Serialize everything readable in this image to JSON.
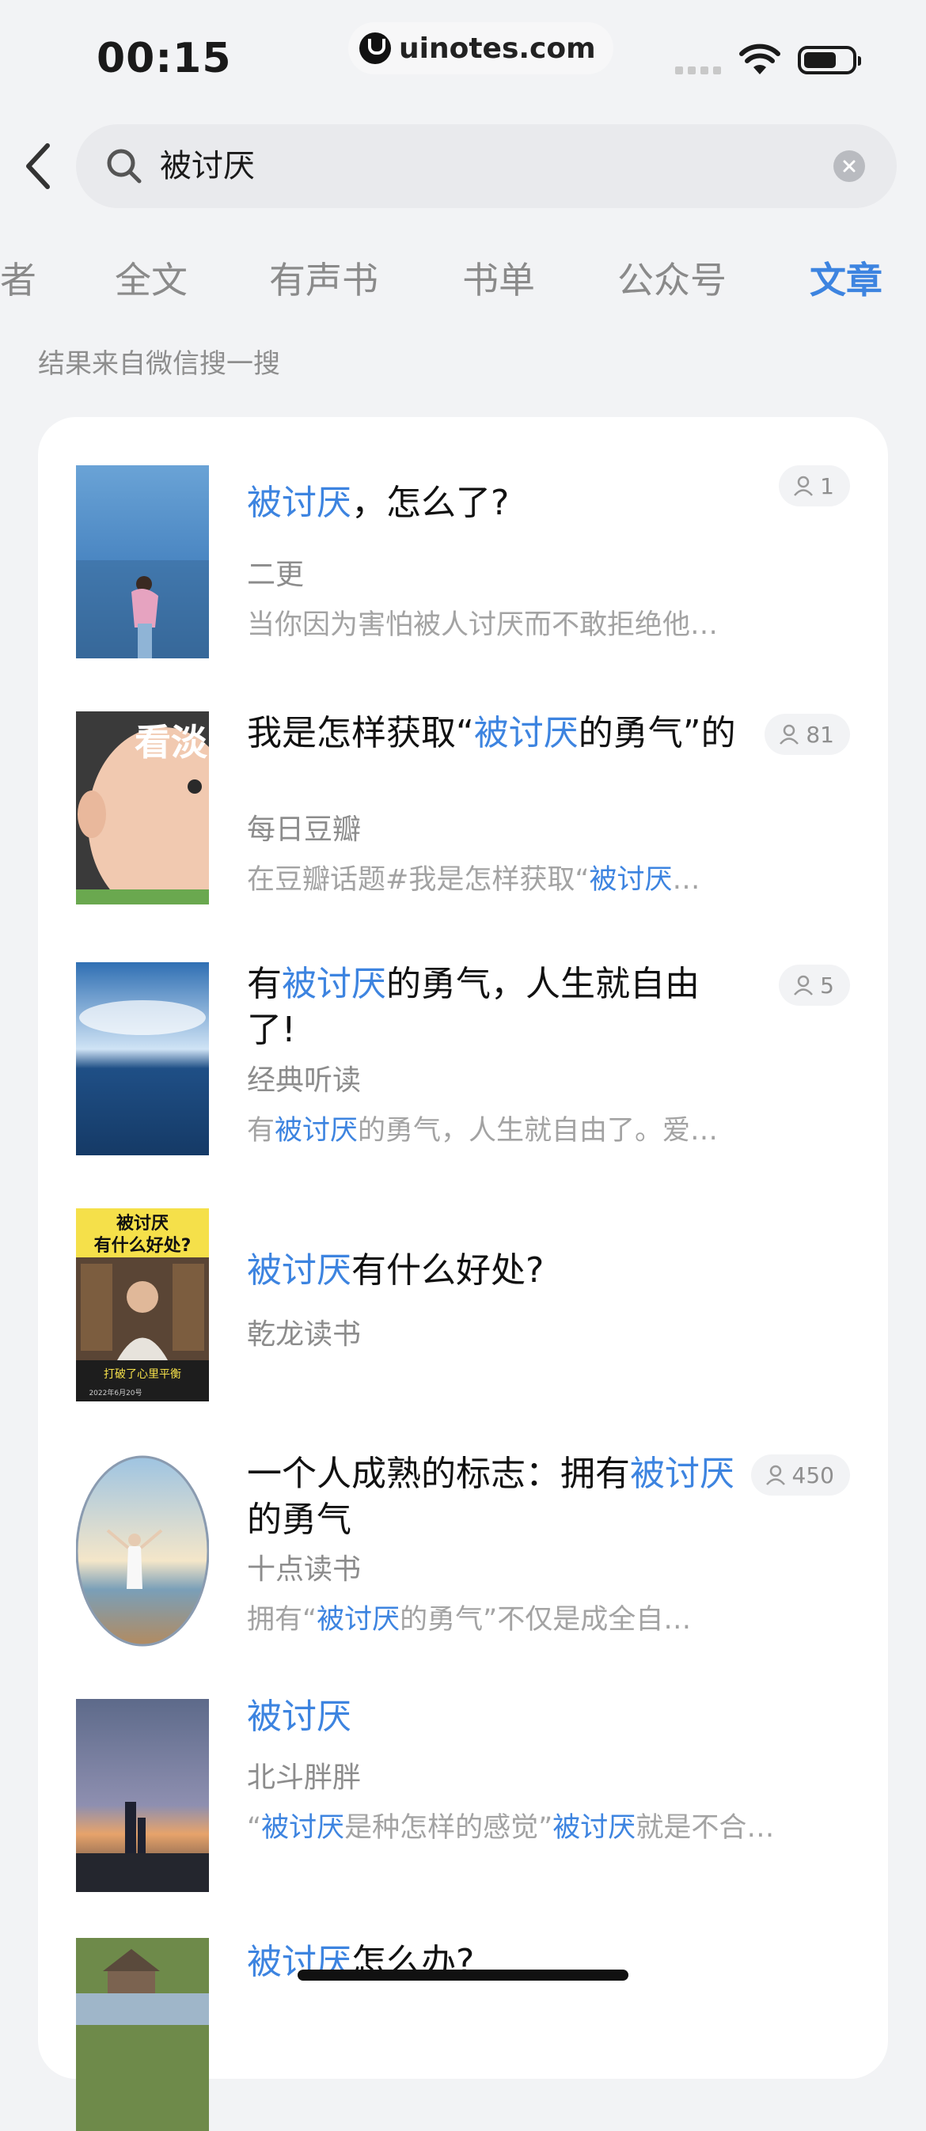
{
  "status_bar": {
    "time": "00:15",
    "watermark": "uinotes.com"
  },
  "search": {
    "query": "被讨厌"
  },
  "tabs": [
    {
      "label": "者",
      "active": false
    },
    {
      "label": "全文",
      "active": false
    },
    {
      "label": "有声书",
      "active": false
    },
    {
      "label": "书单",
      "active": false
    },
    {
      "label": "公众号",
      "active": false
    },
    {
      "label": "文章",
      "active": true
    }
  ],
  "source_note": "结果来自微信搜一搜",
  "colors": {
    "accent": "#3d84e0",
    "background": "#f2f3f5",
    "card": "#ffffff",
    "muted": "#a3a3a3"
  },
  "results": [
    {
      "title_parts": [
        {
          "t": "被讨厌",
          "hl": true
        },
        {
          "t": "，怎么了?",
          "hl": false
        }
      ],
      "author": "二更",
      "snippet_parts": [
        {
          "t": "当你因为害怕被人讨厌而不敢拒绝他…",
          "hl": false
        }
      ],
      "readers": "1"
    },
    {
      "title_parts": [
        {
          "t": "我是怎样获取“",
          "hl": false
        },
        {
          "t": "被讨厌",
          "hl": true
        },
        {
          "t": "的勇气”的",
          "hl": false
        }
      ],
      "author": "每日豆瓣",
      "snippet_parts": [
        {
          "t": "在豆瓣话题#我是怎样获取“",
          "hl": false
        },
        {
          "t": "被讨厌",
          "hl": true
        },
        {
          "t": "…",
          "hl": false
        }
      ],
      "readers": "81",
      "thumb_text": "看淡"
    },
    {
      "title_parts": [
        {
          "t": "有",
          "hl": false
        },
        {
          "t": "被讨厌",
          "hl": true
        },
        {
          "t": "的勇气，人生就自由了!",
          "hl": false
        }
      ],
      "author": "经典听读",
      "snippet_parts": [
        {
          "t": "有",
          "hl": false
        },
        {
          "t": "被讨厌",
          "hl": true
        },
        {
          "t": "的勇气，人生就自由了。爱…",
          "hl": false
        }
      ],
      "readers": "5"
    },
    {
      "title_parts": [
        {
          "t": "被讨厌",
          "hl": true
        },
        {
          "t": "有什么好处?",
          "hl": false
        }
      ],
      "author": "乾龙读书",
      "snippet_parts": [],
      "readers": "",
      "thumb_text_1": "被讨厌",
      "thumb_text_2": "有什么好处?",
      "thumb_text_3": "打破了心里平衡",
      "thumb_text_4": "2022年6月20号"
    },
    {
      "title_parts": [
        {
          "t": "一个人成熟的标志：拥有",
          "hl": false
        },
        {
          "t": "被讨厌",
          "hl": true
        },
        {
          "t": "的勇气",
          "hl": false
        }
      ],
      "author": "十点读书",
      "snippet_parts": [
        {
          "t": "拥有“",
          "hl": false
        },
        {
          "t": "被讨厌",
          "hl": true
        },
        {
          "t": "的勇气”不仅是成全自…",
          "hl": false
        }
      ],
      "readers": "450"
    },
    {
      "title_parts": [
        {
          "t": "被讨厌",
          "hl": true
        }
      ],
      "author": "北斗胖胖",
      "snippet_parts": [
        {
          "t": "“",
          "hl": false
        },
        {
          "t": "被讨厌",
          "hl": true
        },
        {
          "t": "是种怎样的感觉”",
          "hl": false
        },
        {
          "t": "被讨厌",
          "hl": true
        },
        {
          "t": "就是不合…",
          "hl": false
        }
      ],
      "readers": ""
    },
    {
      "title_parts": [
        {
          "t": "被讨厌",
          "hl": true
        },
        {
          "t": "怎么办?",
          "hl": false
        }
      ],
      "author": "",
      "snippet_parts": [],
      "readers": ""
    }
  ]
}
